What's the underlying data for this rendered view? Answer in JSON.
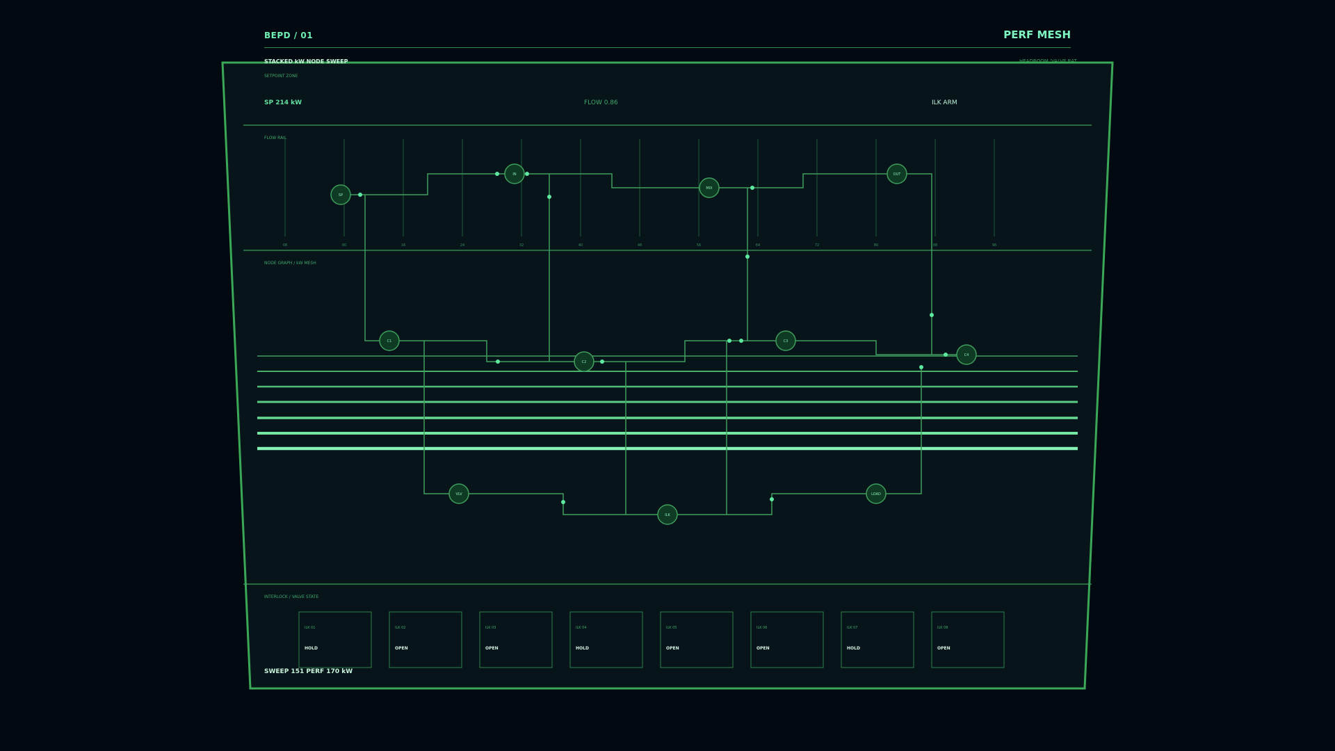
{
  "header": {
    "code": "BEPD / 01",
    "title": "PERF MESH"
  },
  "subheader": {
    "title": "STACKED kW NODE SWEEP",
    "right": "HEADROOM 'VALVE RAT"
  },
  "setpoint_zone": {
    "caption": "SETPOINT ZONE",
    "sp": "SP 214 kW",
    "flow": "FLOW 0.86",
    "ilk": "ILK ARM"
  },
  "flow_rail": {
    "caption": "FLOW RAIL",
    "ticks": [
      "08",
      "00",
      "16",
      "24",
      "32",
      "40",
      "48",
      "56",
      "64",
      "72",
      "80",
      "88",
      "96"
    ]
  },
  "node_graph": {
    "caption": "NODE GRAPH / kW MESH",
    "nodes": [
      {
        "id": "sp",
        "label": "SP"
      },
      {
        "id": "in",
        "label": "IN"
      },
      {
        "id": "mix",
        "label": "MIX"
      },
      {
        "id": "out",
        "label": "OUT"
      },
      {
        "id": "c1",
        "label": "C1"
      },
      {
        "id": "c2",
        "label": "C2"
      },
      {
        "id": "c3",
        "label": "C3"
      },
      {
        "id": "c4",
        "label": "C4"
      },
      {
        "id": "vlv",
        "label": "VLV"
      },
      {
        "id": "ilk",
        "label": "ILK"
      },
      {
        "id": "load",
        "label": "LOAD"
      }
    ]
  },
  "interlock": {
    "caption": "INTERLOCK / VALVE STATE",
    "valves": [
      {
        "id": "ILK 01",
        "state": "HOLD"
      },
      {
        "id": "ILK 02",
        "state": "OPEN"
      },
      {
        "id": "ILK 03",
        "state": "OPEN"
      },
      {
        "id": "ILK 04",
        "state": "HOLD"
      },
      {
        "id": "ILK 05",
        "state": "OPEN"
      },
      {
        "id": "ILK 06",
        "state": "OPEN"
      },
      {
        "id": "ILK 07",
        "state": "HOLD"
      },
      {
        "id": "ILK 08",
        "state": "OPEN"
      }
    ]
  },
  "footer": {
    "status": "SWEEP 151 PERF 170 kW"
  },
  "colors": {
    "bg": "#020910",
    "panel": "#07141a",
    "frame": "#3aa857",
    "line": "#3f9e5c",
    "accent": "#6ff0b4"
  }
}
